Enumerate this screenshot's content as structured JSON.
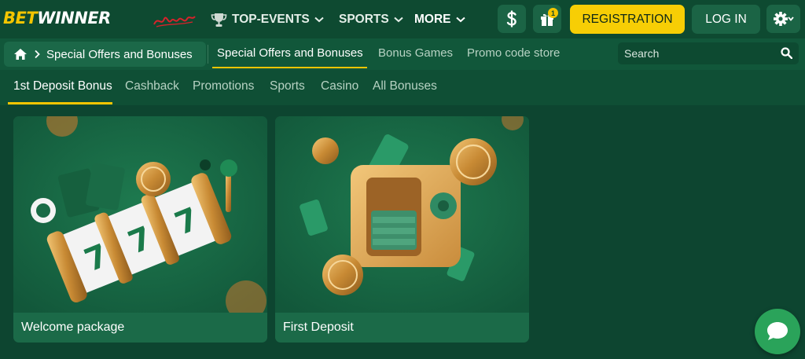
{
  "header": {
    "logo_part1": "BET",
    "logo_part2": "WINNER",
    "nav": [
      {
        "label": "TOP-EVENTS",
        "icon": "trophy-icon"
      },
      {
        "label": "SPORTS",
        "icon": "chevron-down-icon"
      },
      {
        "label": "MORE",
        "icon": "chevron-down-icon"
      }
    ],
    "deposit_icon": "dollar-icon",
    "gift_icon": "gift-icon",
    "gift_badge": "1",
    "registration_label": "REGISTRATION",
    "login_label": "LOG IN",
    "settings_icon": "gear-icon"
  },
  "breadcrumb": {
    "home_icon": "home-icon",
    "current": "Special Offers and Bonuses"
  },
  "subnav": {
    "tabs": [
      {
        "label": "Special Offers and Bonuses",
        "active": true
      },
      {
        "label": "Bonus Games",
        "active": false
      },
      {
        "label": "Promo code store",
        "active": false
      }
    ],
    "search_placeholder": "Search"
  },
  "bonus_tabs": [
    {
      "label": "1st Deposit Bonus",
      "active": true
    },
    {
      "label": "Cashback",
      "active": false
    },
    {
      "label": "Promotions",
      "active": false
    },
    {
      "label": "Sports",
      "active": false
    },
    {
      "label": "Casino",
      "active": false
    },
    {
      "label": "All Bonuses",
      "active": false
    }
  ],
  "cards": [
    {
      "title": "Welcome package",
      "image": "slot-machine-777"
    },
    {
      "title": "First Deposit",
      "image": "open-safe-with-coins"
    }
  ],
  "chat_icon": "chat-bubble-icon",
  "colors": {
    "accent_yellow": "#f7ce05",
    "header_bg": "#0e4a31",
    "page_bg": "#0d4530",
    "button_green": "#1b6445",
    "chat_green": "#2aa35a"
  }
}
